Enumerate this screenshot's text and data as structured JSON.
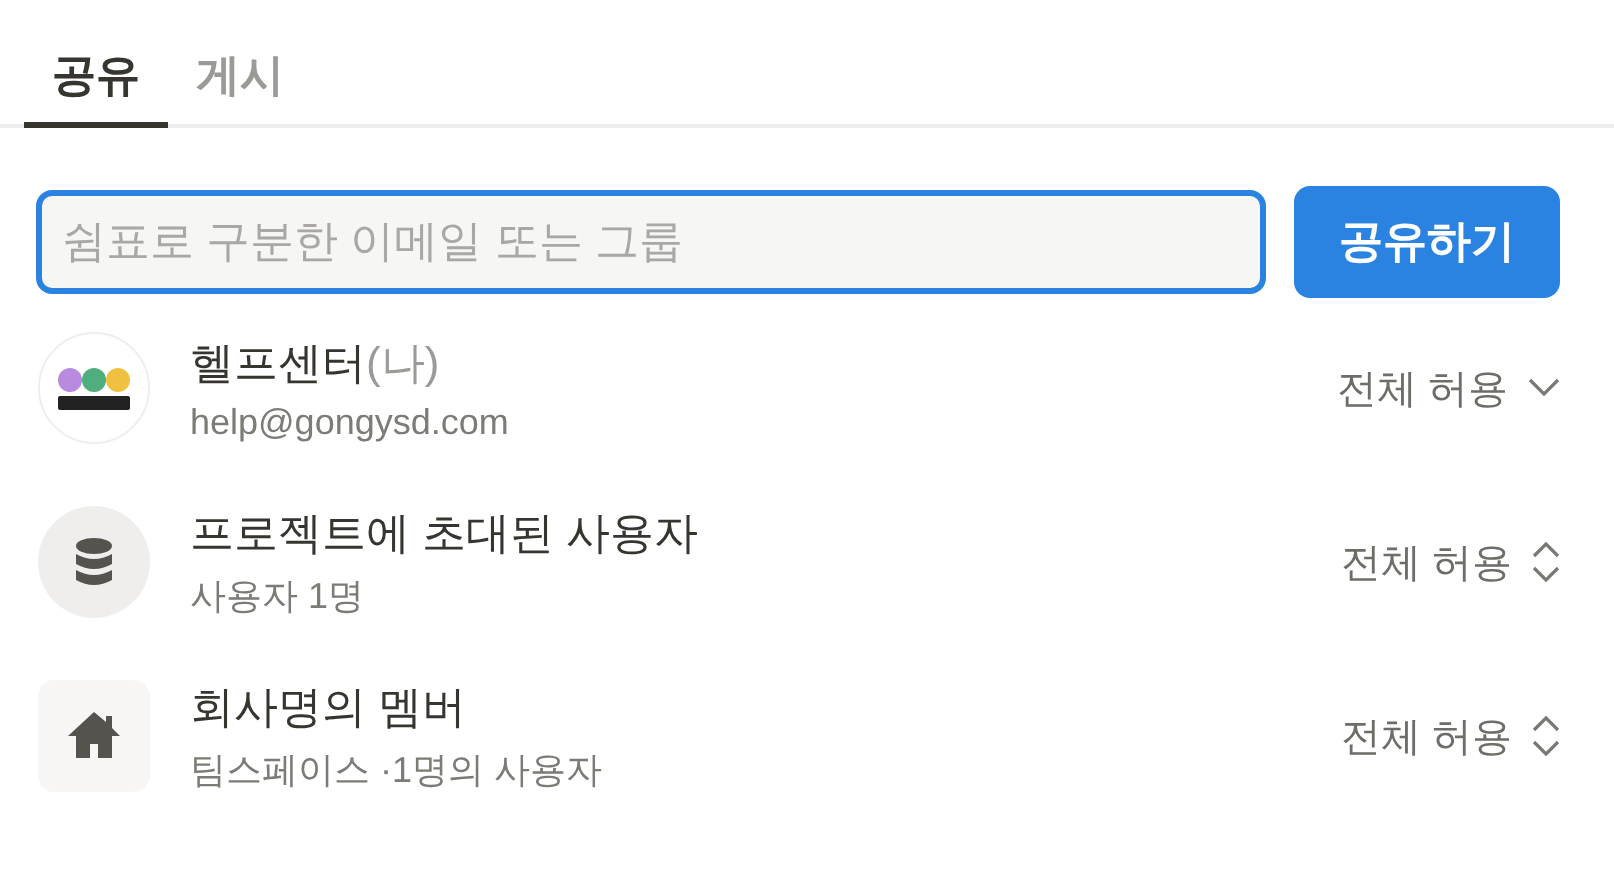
{
  "tabs": [
    {
      "label": "공유",
      "selected": true
    },
    {
      "label": "게시",
      "selected": false
    }
  ],
  "invite": {
    "placeholder": "쉼표로 구분한 이메일 또는 그룹",
    "button": "공유하기"
  },
  "members": [
    {
      "kind": "avatar",
      "name": "헬프센터",
      "tag": "(나)",
      "detail": "help@gongysd.com",
      "access": "전체 허용",
      "updown_caret": false
    },
    {
      "kind": "database",
      "name": "프로젝트에 초대된 사용자",
      "detail": "사용자 1명",
      "access": "전체 허용",
      "updown_caret": true
    },
    {
      "kind": "home",
      "name": "회사명의 멤버",
      "detail": "팀스페이스 ·1명의 사용자",
      "access": "전체 허용",
      "updown_caret": true
    }
  ]
}
